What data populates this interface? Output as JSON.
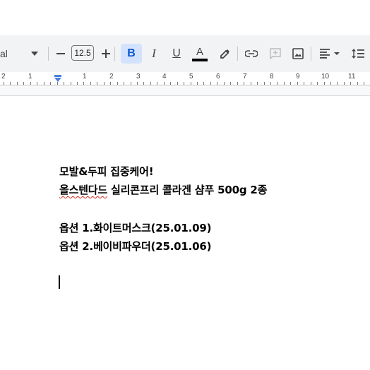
{
  "toolbar": {
    "font_name": "al",
    "font_size": "12.5",
    "bold_label": "B",
    "italic_label": "I",
    "underline_label": "U",
    "text_color_label": "A",
    "text_color": "#000000",
    "icons": [
      "chevron-down-icon",
      "minus-icon",
      "plus-icon",
      "highlighter-icon",
      "link-icon",
      "add-comment-icon",
      "insert-image-icon",
      "align-left-icon",
      "line-spacing-icon"
    ]
  },
  "ruler": {
    "numbers": [
      "2",
      "1",
      "1",
      "2",
      "3",
      "4",
      "5",
      "6",
      "7",
      "8",
      "9",
      "10",
      "11"
    ]
  },
  "document": {
    "line1": "모발&두피 집중케어!",
    "line2_misspelled": "올스텐다드",
    "line2_rest": " 실리콘프리 콜라겐 샴푸 500g 2종",
    "line3": "옵션 1.화이트머스크(25.01.09)",
    "line4": "옵션 2.베이비파우더(25.01.06)"
  }
}
